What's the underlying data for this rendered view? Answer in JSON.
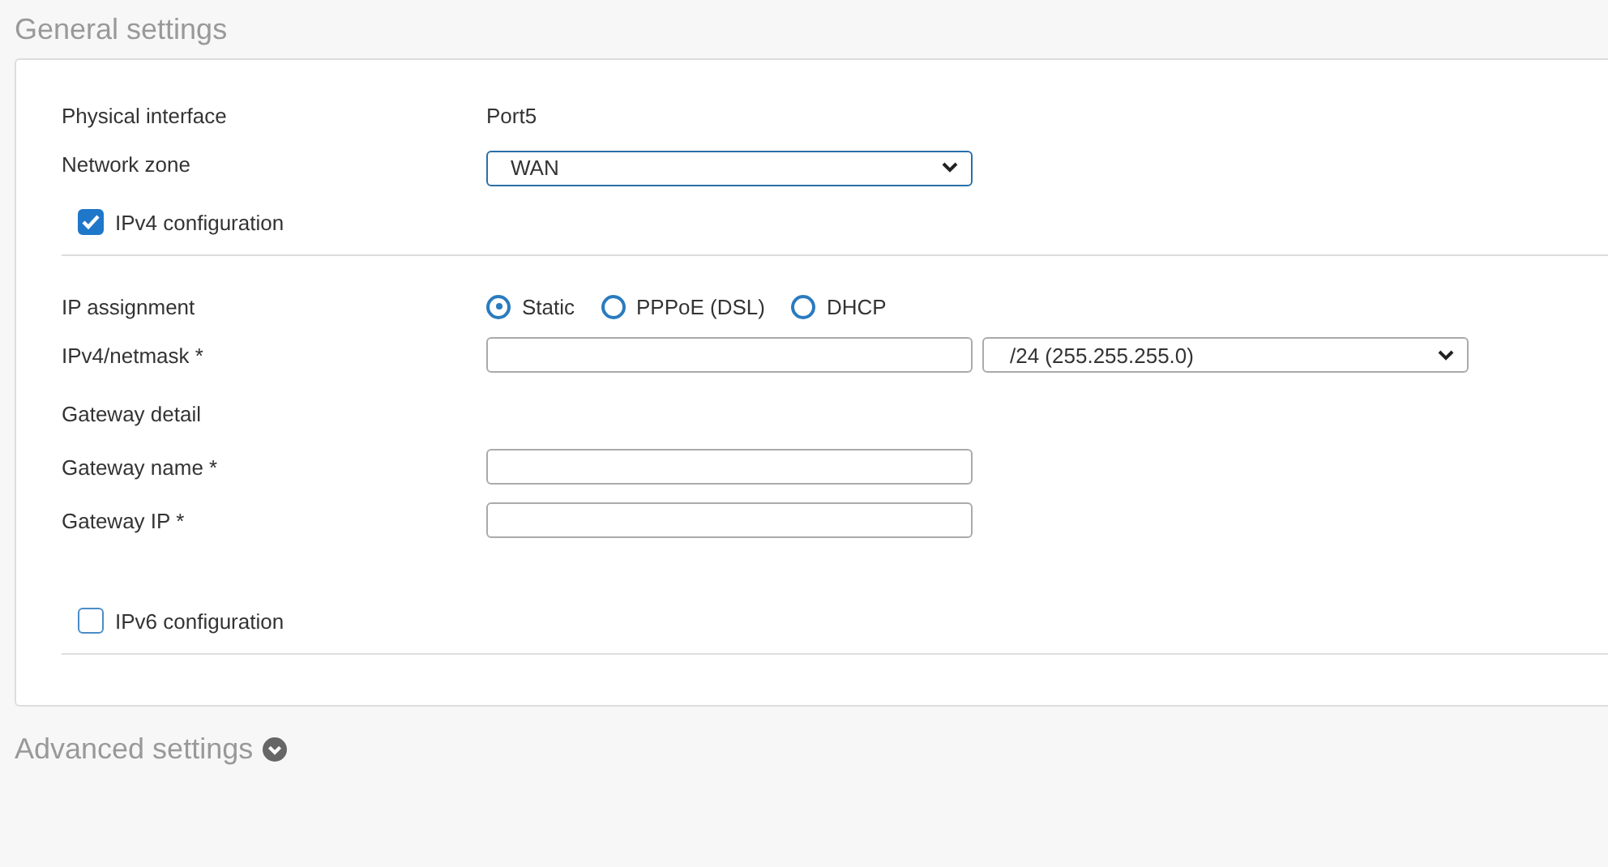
{
  "general_settings": {
    "title": "General settings",
    "top_rows": [
      {
        "kind": "text",
        "label": "Physical interface",
        "value": "Port5"
      },
      {
        "kind": "select",
        "label": "Network zone",
        "value": "WAN"
      }
    ],
    "ipv4": {
      "label": "IPv4 configuration",
      "checked": true
    },
    "rows": [
      {
        "kind": "radio",
        "label": "IP assignment",
        "options": [
          {
            "label": "Static",
            "selected": true
          },
          {
            "label": "PPPoE (DSL)",
            "selected": false
          },
          {
            "label": "DHCP",
            "selected": false
          }
        ]
      },
      {
        "kind": "input_select",
        "label": "IPv4/netmask *",
        "select_value": "/24 (255.255.255.0)"
      },
      {
        "kind": "heading",
        "label": "Gateway detail"
      },
      {
        "kind": "input",
        "label": "Gateway name *"
      },
      {
        "kind": "input",
        "label": "Gateway IP *"
      }
    ],
    "ipv6": {
      "label": "IPv6 configuration",
      "checked": false
    }
  },
  "advanced_settings": {
    "title": "Advanced settings",
    "expanded": false
  }
}
